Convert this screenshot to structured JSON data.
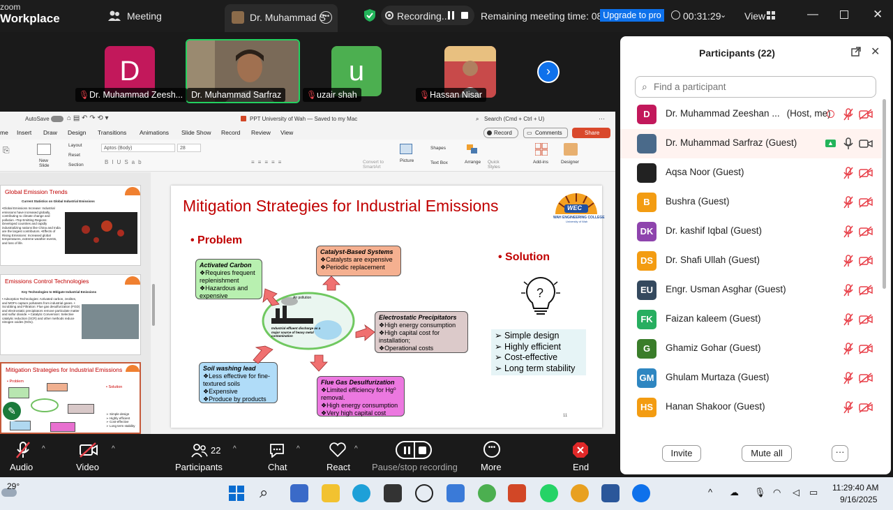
{
  "app": {
    "brand_top": "zoom",
    "brand_name": "Workplace",
    "meeting_label": "Meeting",
    "tab_title": "Dr. Muhammad S",
    "recording_label": "Recording...",
    "remaining_time": "Remaining meeting time: 08:36",
    "upgrade_label": "Upgrade to pro",
    "elapsed": "00:31:29",
    "view_label": "View"
  },
  "strip": {
    "tiles": [
      {
        "letter": "D",
        "name": "Dr. Muhammad Zeesh...",
        "color": "#c2185b"
      },
      {
        "letter": "",
        "name": "Dr. Muhammad Sarfraz",
        "color": "#3a3a3a"
      },
      {
        "letter": "u",
        "name": "uzair shah",
        "color": "#4caf50"
      },
      {
        "letter": "",
        "name": "Hassan Nisar",
        "color": "#8a2e2e"
      }
    ]
  },
  "ppt": {
    "autosave": "AutoSave",
    "doc_title": "PPT University of Wah — Saved to my Mac",
    "search": "Search (Cmd + Ctrl + U)",
    "menu": [
      "me",
      "Insert",
      "Draw",
      "Design",
      "Transitions",
      "Animations",
      "Slide Show",
      "Record",
      "Review",
      "View"
    ],
    "record_btn": "Record",
    "comments_btn": "Comments",
    "share_btn": "Share",
    "ribbon": {
      "layout": "Layout",
      "reset": "Reset",
      "section": "Section",
      "new_slide": "New Slide",
      "font": "Aptos (Body)",
      "size": "28",
      "convert": "Convert to SmartArt",
      "picture": "Picture",
      "shapes": "Shapes",
      "textbox": "Text Box",
      "arrange": "Arrange",
      "quick_styles": "Quick Styles",
      "addins": "Add-ins",
      "designer": "Designer"
    },
    "thumbs": [
      {
        "title": "Global Emission Trends",
        "subtitle": "Current Statistics on Global Industrial Emissions",
        "body": "•Global Emissions Increase: Industrial emissions have increased globally, contributing to climate change and pollution. •Top Emitting Regions: Developed countries and rapidly industrializing nations like China and India are the largest contributors. •Effects of Rising Emissions: Increased global temperatures, extreme weather events, and loss of life."
      },
      {
        "title": "Emissions Control Technologies",
        "subtitle": "Key Technologies to Mitigate Industrial Emissions",
        "body": "• Adsorption Technologies: Activated carbon, zeolites, and MOFs capture pollutants from industrial gases. • Scrubbing and Filtration: Flue gas desulfurization (FGD) and electrostatic precipitators remove particulate matter and sulfur dioxide. • Catalytic Conversion: Selective catalytic reduction (SCR) and other methods reduce nitrogen oxides (NOx)."
      },
      {
        "title": "Mitigation Strategies for Industrial Emissions",
        "subtitle": "",
        "body": ""
      }
    ],
    "thumb3_bits": {
      "problem": "• Problem",
      "solution": "• Solution",
      "list": [
        "➢ Simple design",
        "➢ Highly efficient",
        "➢ Cost-effective",
        "➢ Long term stability"
      ]
    }
  },
  "slide": {
    "title": "Mitigation Strategies for Industrial Emissions",
    "logo_text": "WEC",
    "logo_caption": "WAH ENGINEERING COLLEGE",
    "logo_sub": "University of Wah",
    "problem": "• Problem",
    "solution": "• Solution",
    "center_label1": "Air pollution",
    "center_label2": "Industrial effluent discharge as a major source of heavy metal contamination",
    "boxes": {
      "activated": {
        "title": "Activated Carbon",
        "lines": [
          "❖Requires frequent replenishment",
          "❖Hazardous and expensive"
        ]
      },
      "catalyst": {
        "title": "Catalyst-Based Systems",
        "lines": [
          "❖Catalysts are expensive",
          "❖Periodic replacement"
        ]
      },
      "electro": {
        "title": "Electrostatic Precipitators",
        "lines": [
          "❖High energy consumption",
          "❖High capital cost for installation;",
          "❖Operational costs"
        ]
      },
      "soil": {
        "title": "Soil washing lead",
        "lines": [
          "❖Less effective for fine-textured soils",
          "❖Expensive",
          "❖Produce by products"
        ]
      },
      "flue": {
        "title": "Flue Gas Desulfurization",
        "lines": [
          "❖Limited efficiency for Hg⁰ removal.",
          "❖High energy consumption",
          "❖Very high capital cost"
        ]
      }
    },
    "solution_list": [
      "➢ Simple design",
      "➢ Highly efficient",
      "➢ Cost-effective",
      "➢ Long term stability"
    ],
    "page_no": "11"
  },
  "toolbar": {
    "audio": "Audio",
    "video": "Video",
    "participants": "Participants",
    "participants_count": "22",
    "chat": "Chat",
    "react": "React",
    "pause_rec": "Pause/stop recording",
    "more": "More",
    "end": "End"
  },
  "panel": {
    "title": "Participants (22)",
    "search_placeholder": "Find a participant",
    "participants": [
      {
        "initials": "D",
        "name": "Dr. Muhammad Zeeshan ...",
        "role": "(Host, me)",
        "color": "#c2185b"
      },
      {
        "initials": "",
        "name": "Dr. Muhammad Sarfraz (Guest)",
        "role": "",
        "color": "#4a6a8a"
      },
      {
        "initials": "",
        "name": "Aqsa Noor (Guest)",
        "role": "",
        "color": "#222222"
      },
      {
        "initials": "B",
        "name": "Bushra (Guest)",
        "role": "",
        "color": "#f39c12"
      },
      {
        "initials": "DK",
        "name": "Dr. kashif Iqbal (Guest)",
        "role": "",
        "color": "#8e44ad"
      },
      {
        "initials": "DS",
        "name": "Dr. Shafi Ullah (Guest)",
        "role": "",
        "color": "#f39c12"
      },
      {
        "initials": "EU",
        "name": "Engr. Usman Asghar (Guest)",
        "role": "",
        "color": "#34495e"
      },
      {
        "initials": "FK",
        "name": "Faizan kaleem (Guest)",
        "role": "",
        "color": "#27ae60"
      },
      {
        "initials": "G",
        "name": "Ghamiz Gohar (Guest)",
        "role": "",
        "color": "#3a7d2a"
      },
      {
        "initials": "GM",
        "name": "Ghulam Murtaza (Guest)",
        "role": "",
        "color": "#2e86c1"
      },
      {
        "initials": "HS",
        "name": "Hanan Shakoor (Guest)",
        "role": "",
        "color": "#f39c12"
      }
    ],
    "invite": "Invite",
    "mute_all": "Mute all",
    "more": "···"
  },
  "taskbar": {
    "weather": "29°",
    "time": "11:29:40 AM",
    "date": "9/16/2025"
  }
}
